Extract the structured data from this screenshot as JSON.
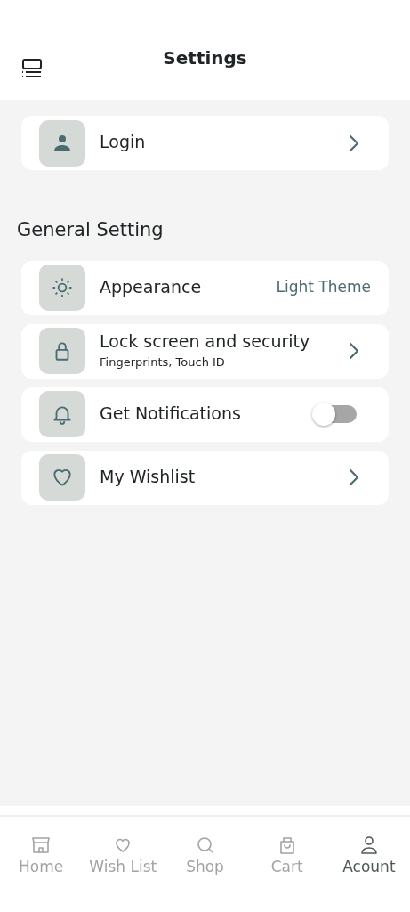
{
  "header": {
    "title": "Settings"
  },
  "account": {
    "label": "Login",
    "kind": "link"
  },
  "section_title": "General Setting",
  "settings": [
    {
      "label": "Appearance",
      "kind": "value",
      "value": "Light Theme"
    },
    {
      "label": "Lock screen and security",
      "kind": "link",
      "subtitle": "Fingerprints, Touch ID"
    },
    {
      "label": "Get Notifications",
      "kind": "toggle",
      "on": false
    },
    {
      "label": "My Wishlist",
      "kind": "link"
    }
  ],
  "bottom_nav": [
    {
      "label": "Home",
      "selected": false
    },
    {
      "label": "Wish List",
      "selected": false
    },
    {
      "label": "Shop",
      "selected": false
    },
    {
      "label": "Cart",
      "selected": false
    },
    {
      "label": "Acount",
      "selected": true
    }
  ]
}
